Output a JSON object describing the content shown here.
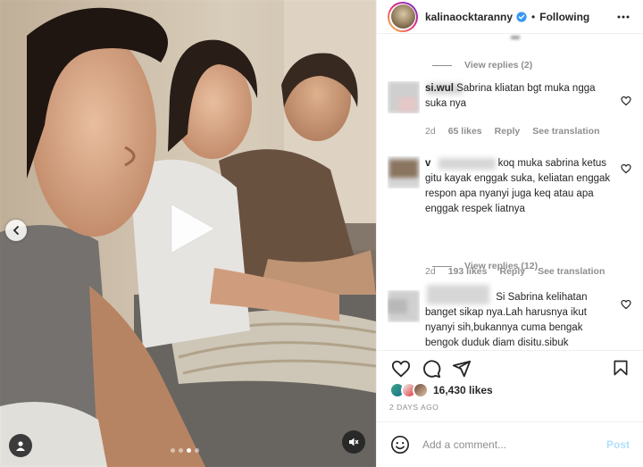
{
  "header": {
    "username": "kalinaocktaranny",
    "separator": "•",
    "follow_status": "Following"
  },
  "comments_list": [
    {
      "type": "view_replies",
      "label": "View replies (2)"
    },
    {
      "type": "comment",
      "username_visible": "si.wul",
      "text": "Sabrina kliatan bgt muka ngga suka nya",
      "meta": {
        "time": "2d",
        "likes": "65 likes",
        "reply": "Reply",
        "translate": "See translation"
      }
    },
    {
      "type": "comment",
      "username_visible": "v",
      "text": "koq muka sabrina ketus gitu kayak enggak suka, keliatan enggak respon apa nyanyi juga keq atau apa enggak respek liatnya",
      "meta": {
        "time": "2d",
        "likes": "193 likes",
        "reply": "Reply",
        "translate": "See translation"
      }
    },
    {
      "type": "view_replies",
      "label": "View replies (12)"
    },
    {
      "type": "comment",
      "username_visible": "",
      "text": "Si Sabrina kelihatan banget sikap nya.Lah harusnya ikut nyanyi sih,bukannya cuma bengak bengok duduk diam disitu.sibuk"
    }
  ],
  "actions": {
    "like_icon": "heart-icon",
    "comment_icon": "comment-icon",
    "share_icon": "share-icon",
    "save_icon": "bookmark-icon"
  },
  "likes": {
    "count": "16,430 likes"
  },
  "time_ago": "2 DAYS AGO",
  "add_comment": {
    "placeholder": "Add a comment...",
    "post_label": "Post"
  },
  "media": {
    "carousel_dots": 4,
    "active_dot": 3,
    "play_icon": "play-icon",
    "prev_icon": "chevron-left-icon",
    "tag_icon": "user-tag-icon",
    "mute_icon": "speaker-muted-icon"
  },
  "colors": {
    "verified": "#3897f0",
    "post_disabled": "#b2dffc",
    "muted_text": "#8e8e8e"
  }
}
